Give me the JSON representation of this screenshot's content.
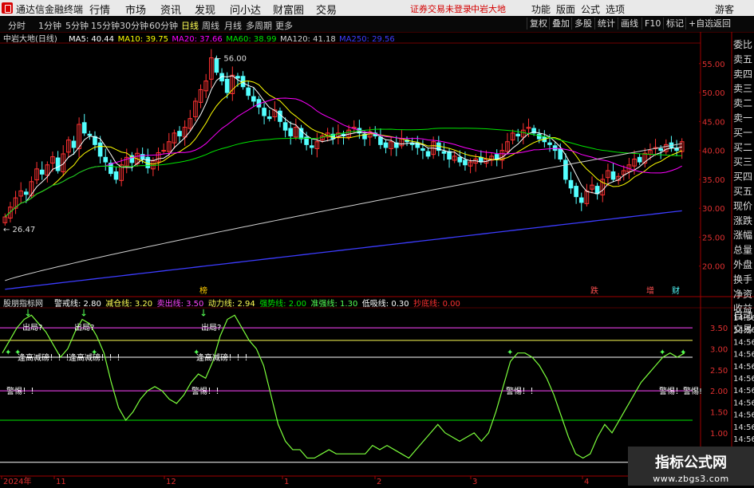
{
  "app": {
    "name": "通达信金融终端"
  },
  "menu": {
    "items": [
      "行情",
      "市场",
      "资讯",
      "发现",
      "问小达",
      "财富圈",
      "交易"
    ],
    "notice": "证券交易未登录",
    "stock": "中岩大地",
    "right_items": [
      "功能",
      "版面",
      "公式",
      "选项"
    ],
    "user": "游客"
  },
  "periods": {
    "items": [
      "分时",
      "1分钟",
      "5分钟",
      "15分钟",
      "30分钟",
      "60分钟",
      "日线",
      "周线",
      "月线",
      "多周期",
      "更多"
    ],
    "active": "日线"
  },
  "tools": [
    "复权",
    "叠加",
    "多股",
    "统计",
    "画线",
    "F10",
    "标记",
    "+自选",
    "返回"
  ],
  "side_panel": [
    "委比",
    "卖五",
    "卖四",
    "卖三",
    "卖二",
    "卖一",
    "买一",
    "买二",
    "买三",
    "买四",
    "买五",
    "现价",
    "涨跌",
    "涨幅",
    "总量",
    "外盘",
    "换手",
    "净资",
    "收益"
  ],
  "side_panel2": [
    "自动",
    "交易"
  ],
  "colors": {
    "up": "#ff3232",
    "down": "#54ffff",
    "ma5": "#ffffff",
    "ma10": "#ffff00",
    "ma20": "#ff00ff",
    "ma60": "#00e600",
    "ma120": "#d0d0d0",
    "ma250": "#3c3cff"
  },
  "chart_data": [
    {
      "type": "candlestick",
      "title": "中岩大地(日线)",
      "legend": [
        {
          "name": "MA5",
          "value": "40.44",
          "color": "#ffffff"
        },
        {
          "name": "MA10",
          "value": "39.75",
          "color": "#ffff00"
        },
        {
          "name": "MA20",
          "value": "37.66",
          "color": "#ff00ff"
        },
        {
          "name": "MA60",
          "value": "38.99",
          "color": "#00e600"
        },
        {
          "name": "MA120",
          "value": "41.18",
          "color": "#d0d0d0"
        },
        {
          "name": "MA250",
          "value": "29.56",
          "color": "#3c3cff"
        }
      ],
      "ylim": [
        15,
        58
      ],
      "yticks": [
        55,
        50,
        45,
        40,
        35,
        30,
        25,
        20
      ],
      "ytick_labels": [
        "55.00",
        "50.00",
        "45.00",
        "40.00",
        "35.00",
        "30.00",
        "25.00",
        "20.00"
      ],
      "annotations": [
        {
          "text": "56.00",
          "value": 56.0
        },
        {
          "text": "26.47",
          "value": 26.47
        }
      ],
      "event_markers": [
        "榜",
        "跌",
        "增",
        "财"
      ],
      "close": [
        28.5,
        30.2,
        31.8,
        33.0,
        32.4,
        34.6,
        36.8,
        35.9,
        37.5,
        38.9,
        36.5,
        39.4,
        41.8,
        40.5,
        44.5,
        43.0,
        42.6,
        41.0,
        39.0,
        38.0,
        36.0,
        35.0,
        37.5,
        38.8,
        37.9,
        39.5,
        38.5,
        37.0,
        38.2,
        39.6,
        40.0,
        41.5,
        43.0,
        42.5,
        44.0,
        45.5,
        48.5,
        50.5,
        52.0,
        56.0,
        53.5,
        52.0,
        50.0,
        53.0,
        52.5,
        51.0,
        49.5,
        48.5,
        47.5,
        46.0,
        45.5,
        47.0,
        45.0,
        43.5,
        42.5,
        44.0,
        42.0,
        41.0,
        40.5,
        41.5,
        42.5,
        43.0,
        42.0,
        43.0,
        42.5,
        43.5,
        44.0,
        43.0,
        42.0,
        43.2,
        42.5,
        41.0,
        40.5,
        41.5,
        40.5,
        42.0,
        41.5,
        41.0,
        40.5,
        40.0,
        39.0,
        41.5,
        40.0,
        39.5,
        38.5,
        39.0,
        38.0,
        37.5,
        38.0,
        38.5,
        38.0,
        38.5,
        39.0,
        38.5,
        40.0,
        41.5,
        43.0,
        42.5,
        43.5,
        44.0,
        43.0,
        42.0,
        41.5,
        41.0,
        40.0,
        38.5,
        35.0,
        33.5,
        32.0,
        31.0,
        33.0,
        34.0,
        32.5,
        35.0,
        36.5,
        35.0,
        35.5,
        36.5,
        37.5,
        38.5,
        38.0,
        39.5,
        40.0,
        40.5,
        40.0,
        41.0,
        40.5,
        40.0,
        41.5
      ],
      "ma_note": "moving averages drawn from listed values"
    },
    {
      "type": "line",
      "title": "股朋指标网",
      "legend": [
        {
          "name": "警戒线",
          "value": "2.80",
          "color": "#ffffff"
        },
        {
          "name": "减仓线",
          "value": "3.20",
          "color": "#ffff54"
        },
        {
          "name": "卖出线",
          "value": "3.50",
          "color": "#ff44ff"
        },
        {
          "name": "动力线",
          "value": "2.94",
          "color": "#ffff54"
        },
        {
          "name": "强势线",
          "value": "2.00",
          "color": "#00e600"
        },
        {
          "name": "准强线",
          "value": "1.30",
          "color": "#54ff54"
        },
        {
          "name": "低吸线",
          "value": "0.30",
          "color": "#ffffff"
        },
        {
          "name": "抄底线",
          "value": "0.00",
          "color": "#ff3030"
        }
      ],
      "ylim": [
        0.2,
        3.9
      ],
      "yticks": [
        3.5,
        3.0,
        2.5,
        2.0,
        1.5,
        1.0
      ],
      "ytick_labels": [
        "3.50",
        "3.00",
        "2.50",
        "2.00",
        "1.50",
        "1.00"
      ],
      "hlines": [
        {
          "value": 3.5,
          "color": "#ff44ff"
        },
        {
          "value": 3.2,
          "color": "#ffff54"
        },
        {
          "value": 2.8,
          "color": "#ffffff"
        },
        {
          "value": 2.0,
          "color": "#ff44ff"
        },
        {
          "value": 1.3,
          "color": "#00e600"
        },
        {
          "value": 0.3,
          "color": "#ffffff"
        }
      ],
      "line": [
        2.9,
        3.2,
        3.5,
        3.7,
        3.8,
        3.6,
        3.4,
        3.1,
        2.8,
        3.0,
        3.4,
        3.7,
        3.6,
        3.3,
        2.9,
        2.2,
        1.6,
        1.3,
        1.5,
        1.8,
        2.0,
        2.1,
        2.0,
        1.8,
        1.7,
        1.9,
        2.2,
        2.4,
        2.3,
        2.7,
        3.3,
        3.7,
        3.8,
        3.5,
        3.2,
        3.0,
        2.6,
        1.9,
        1.2,
        0.8,
        0.6,
        0.6,
        0.4,
        0.4,
        0.5,
        0.6,
        0.5,
        0.5,
        0.5,
        0.5,
        0.5,
        0.7,
        0.6,
        0.7,
        0.6,
        0.5,
        0.4,
        0.6,
        0.8,
        1.0,
        1.2,
        1.0,
        0.9,
        0.8,
        0.9,
        1.0,
        0.8,
        1.0,
        1.5,
        2.1,
        2.7,
        2.9,
        2.9,
        2.8,
        2.6,
        2.3,
        1.9,
        1.4,
        0.9,
        0.5,
        0.4,
        0.5,
        0.9,
        1.2,
        1.0,
        1.3,
        1.6,
        1.9,
        2.2,
        2.4,
        2.6,
        2.8,
        2.9,
        2.8,
        2.9
      ],
      "annotations": [
        "出局?",
        "出局?",
        "出局?",
        "逢高减磅！！！",
        "逢高减磅！！！",
        "逢高减磅！！！",
        "警惕！！",
        "警惕！！",
        "警惕！！",
        "警惕！警惕!"
      ],
      "right_ticks": [
        "14:56",
        "14:56",
        "14:56",
        "14:56",
        "14:56",
        "14:56",
        "14:56",
        "14:56",
        "14:56",
        "14:56",
        "14:56",
        "14:56",
        "14:56"
      ]
    }
  ],
  "xaxis": {
    "labels": [
      "2024年",
      "11",
      "12",
      "1",
      "2",
      "3",
      "4"
    ]
  },
  "watermark": {
    "line1": "指标公式网",
    "line2": "www.zbgs3.com"
  }
}
